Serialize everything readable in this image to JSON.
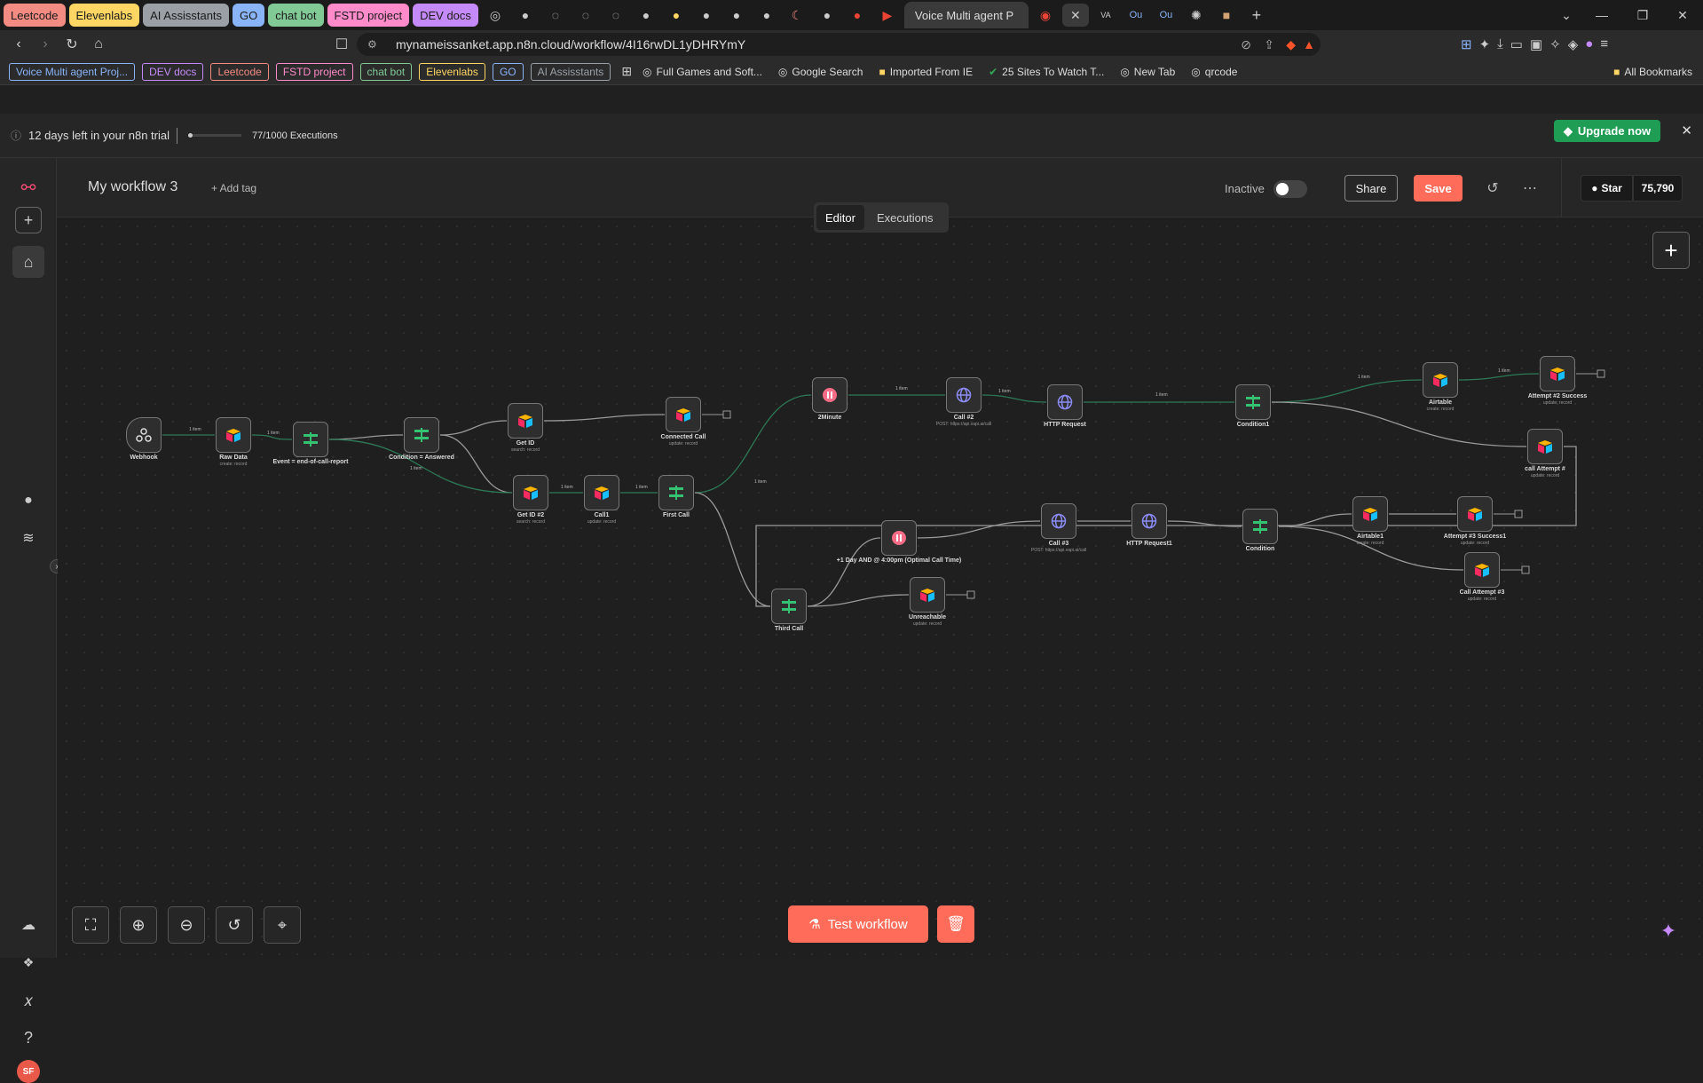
{
  "browser": {
    "tab_groups": [
      {
        "label": "Leetcode",
        "bg": "#f28b82"
      },
      {
        "label": "Elevenlabs",
        "bg": "#fdd663"
      },
      {
        "label": "AI Assisstants",
        "bg": "#9aa0a6"
      },
      {
        "label": "GO",
        "bg": "#8ab4f8"
      },
      {
        "label": "chat bot",
        "bg": "#81c995"
      },
      {
        "label": "FSTD project",
        "bg": "#ff8bcb"
      },
      {
        "label": "DEV docs",
        "bg": "#c58af9"
      }
    ],
    "active_tab": "Voice Multi agent P",
    "url": "mynameissanket.app.n8n.cloud/workflow/4I16rwDL1yDHRYmY",
    "bookmark_groups": [
      {
        "label": "Voice Multi agent Proj...",
        "color": "#8ab4f8"
      },
      {
        "label": "DEV docs",
        "color": "#c58af9"
      },
      {
        "label": "Leetcode",
        "color": "#f28b82"
      },
      {
        "label": "FSTD project",
        "color": "#ff8bcb"
      },
      {
        "label": "chat bot",
        "color": "#81c995"
      },
      {
        "label": "Elevenlabs",
        "color": "#fdd663"
      },
      {
        "label": "GO",
        "color": "#8ab4f8"
      },
      {
        "label": "AI Assisstants",
        "color": "#9aa0a6"
      }
    ],
    "bookmarks": [
      "Full Games and Soft...",
      "Google Search",
      "Imported From IE",
      "25 Sites To Watch T...",
      "New Tab",
      "qrcode"
    ],
    "all_bookmarks": "All Bookmarks"
  },
  "trial": {
    "text": "12 days left in your n8n trial",
    "executions": "77/1000 Executions",
    "progress": 0.077,
    "upgrade": "Upgrade now"
  },
  "header": {
    "workflow_name": "My workflow 3",
    "add_tag": "+ Add tag",
    "inactive": "Inactive",
    "share": "Share",
    "save": "Save",
    "star": "Star",
    "stars": "75,790",
    "tab_editor": "Editor",
    "tab_executions": "Executions"
  },
  "footer": {
    "test_workflow": "Test workflow"
  },
  "user_initials": "SF",
  "colors": {
    "accent": "#ea4b71",
    "save": "#ff6d5a",
    "upgrade": "#1f9d55",
    "edge": "#2d7a56",
    "edge_gray": "#9a9a9a"
  },
  "nodes": [
    {
      "id": "webhook",
      "label": "Webhook",
      "sub": "",
      "icon": "webhook"
    },
    {
      "id": "rawdata",
      "label": "Raw Data",
      "sub": "create: record",
      "icon": "airtable"
    },
    {
      "id": "event",
      "label": "Event = end-of-call-report",
      "sub": "",
      "icon": "if"
    },
    {
      "id": "cond_answered",
      "label": "Condition = Answered",
      "sub": "",
      "icon": "if"
    },
    {
      "id": "getid",
      "label": "Get ID",
      "sub": "search: record",
      "icon": "airtable"
    },
    {
      "id": "connected",
      "label": "Connected Call",
      "sub": "update: record",
      "icon": "airtable"
    },
    {
      "id": "getid2",
      "label": "Get ID #2",
      "sub": "search: record",
      "icon": "airtable"
    },
    {
      "id": "call1",
      "label": "Call1",
      "sub": "update: record",
      "icon": "airtable"
    },
    {
      "id": "firstcall",
      "label": "First Call",
      "sub": "",
      "icon": "if"
    },
    {
      "id": "twominute",
      "label": "2Minute",
      "sub": "",
      "icon": "wait"
    },
    {
      "id": "call2",
      "label": "Call #2",
      "sub": "POST: https://api.vapi.ai/call",
      "icon": "http"
    },
    {
      "id": "httpreq",
      "label": "HTTP Request",
      "sub": "",
      "icon": "http"
    },
    {
      "id": "condition1",
      "label": "Condition1",
      "sub": "",
      "icon": "if"
    },
    {
      "id": "airtable",
      "label": "Airtable",
      "sub": "create: record",
      "icon": "airtable"
    },
    {
      "id": "attempt2",
      "label": "Attempt #2 Success",
      "sub": "update: record",
      "icon": "airtable"
    },
    {
      "id": "callattempt",
      "label": "call Attempt #",
      "sub": "update: record",
      "icon": "airtable"
    },
    {
      "id": "thirdcall",
      "label": "Third Call",
      "sub": "",
      "icon": "if"
    },
    {
      "id": "oneday",
      "label": "+1 Day AND @ 4:00pm (Optimal Call Time)",
      "sub": "",
      "icon": "wait"
    },
    {
      "id": "call3",
      "label": "Call #3",
      "sub": "POST: https://api.vapi.ai/call",
      "icon": "http"
    },
    {
      "id": "httpreq1",
      "label": "HTTP Request1",
      "sub": "",
      "icon": "http"
    },
    {
      "id": "condition",
      "label": "Condition",
      "sub": "",
      "icon": "if"
    },
    {
      "id": "airtable1",
      "label": "Airtable1",
      "sub": "create: record",
      "icon": "airtable"
    },
    {
      "id": "attempt3",
      "label": "Attempt #3 Success1",
      "sub": "update: record",
      "icon": "airtable"
    },
    {
      "id": "callattempt3",
      "label": "Call Attempt #3",
      "sub": "update: record",
      "icon": "airtable"
    },
    {
      "id": "unreachable",
      "label": "Unreachable",
      "sub": "update: record",
      "icon": "airtable"
    }
  ],
  "edge_labels": [
    "1 item",
    "1 item",
    "1 item",
    "1 item",
    "1 item",
    "1 item",
    "1 item",
    "1 item",
    "1 item",
    "1 item",
    "1 item"
  ],
  "port_labels": {
    "true": "true",
    "false": "false",
    "post": "POST"
  }
}
